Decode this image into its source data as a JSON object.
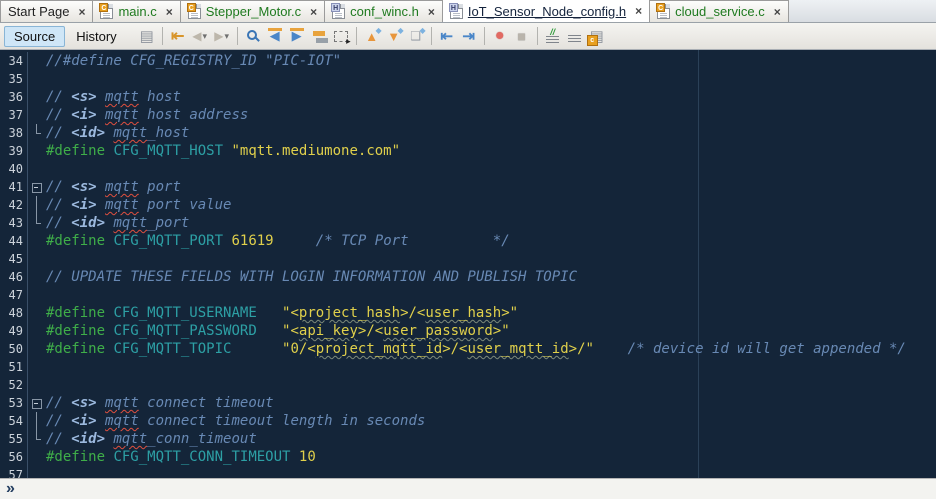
{
  "tabs": [
    {
      "label": "Start Page",
      "icon": null,
      "state": "plain"
    },
    {
      "label": "main.c",
      "icon": "c-file-icon",
      "state": "modified"
    },
    {
      "label": "Stepper_Motor.c",
      "icon": "c-file-icon",
      "state": "modified"
    },
    {
      "label": "conf_winc.h",
      "icon": "h-file-icon",
      "state": "modified"
    },
    {
      "label": "IoT_Sensor_Node_config.h",
      "icon": "h-file-icon",
      "state": "active"
    },
    {
      "label": "cloud_service.c",
      "icon": "c-file-icon",
      "state": "modified"
    }
  ],
  "toolbar": {
    "source_label": "Source",
    "history_label": "History",
    "icons": [
      "last-document",
      "sep",
      "jump-last-edit",
      "back",
      "forward",
      "sep",
      "find",
      "find-previous",
      "find-next",
      "toggle-highlight",
      "rectangular-selection",
      "sep",
      "previous-bookmark",
      "next-bookmark",
      "toggle-bookmark",
      "sep",
      "shift-left",
      "shift-right",
      "sep",
      "record-macro",
      "stop-macro",
      "sep",
      "comment",
      "uncomment",
      "goto-header-source"
    ]
  },
  "editor": {
    "first_line_number": 34,
    "last_line_number": 57,
    "lines": [
      {
        "num": 34,
        "fold": "",
        "segs": [
          [
            "c",
            "//#define CFG_REGISTRY_ID \"PIC-IOT\""
          ]
        ]
      },
      {
        "num": 35,
        "fold": "",
        "segs": []
      },
      {
        "num": 36,
        "fold": "",
        "segs": [
          [
            "c",
            "// "
          ],
          [
            "t",
            "<s>"
          ],
          [
            "c",
            " "
          ],
          [
            "ce",
            "mqtt"
          ],
          [
            "c",
            " host"
          ]
        ]
      },
      {
        "num": 37,
        "fold": "",
        "segs": [
          [
            "c",
            "// "
          ],
          [
            "t",
            "<i>"
          ],
          [
            "c",
            " "
          ],
          [
            "ce",
            "mqtt"
          ],
          [
            "c",
            " host address"
          ]
        ]
      },
      {
        "num": 38,
        "fold": "corner",
        "segs": [
          [
            "c",
            "// "
          ],
          [
            "t",
            "<id>"
          ],
          [
            "c",
            " "
          ],
          [
            "ce",
            "mqtt"
          ],
          [
            "c",
            "_host"
          ]
        ]
      },
      {
        "num": 39,
        "fold": "",
        "segs": [
          [
            "d",
            "#define"
          ],
          [
            "p",
            " "
          ],
          [
            "i",
            "CFG_MQTT_HOST"
          ],
          [
            "p",
            " "
          ],
          [
            "s",
            "\"mqtt.mediumone.com\""
          ]
        ]
      },
      {
        "num": 40,
        "fold": "",
        "segs": []
      },
      {
        "num": 41,
        "fold": "box",
        "segs": [
          [
            "c",
            "// "
          ],
          [
            "t",
            "<s>"
          ],
          [
            "c",
            " "
          ],
          [
            "ce",
            "mqtt"
          ],
          [
            "c",
            " port"
          ]
        ]
      },
      {
        "num": 42,
        "fold": "line",
        "segs": [
          [
            "c",
            "// "
          ],
          [
            "t",
            "<i>"
          ],
          [
            "c",
            " "
          ],
          [
            "ce",
            "mqtt"
          ],
          [
            "c",
            " port value"
          ]
        ]
      },
      {
        "num": 43,
        "fold": "corner",
        "segs": [
          [
            "c",
            "// "
          ],
          [
            "t",
            "<id>"
          ],
          [
            "c",
            " "
          ],
          [
            "ce",
            "mqtt"
          ],
          [
            "c",
            "_port"
          ]
        ]
      },
      {
        "num": 44,
        "fold": "",
        "segs": [
          [
            "d",
            "#define"
          ],
          [
            "p",
            " "
          ],
          [
            "i",
            "CFG_MQTT_PORT"
          ],
          [
            "p",
            " "
          ],
          [
            "n",
            "61619"
          ],
          [
            "p",
            "     "
          ],
          [
            "c",
            "/* TCP Port          */"
          ]
        ]
      },
      {
        "num": 45,
        "fold": "",
        "segs": []
      },
      {
        "num": 46,
        "fold": "",
        "segs": [
          [
            "c",
            "// UPDATE THESE FIELDS WITH LOGIN INFORMATION AND PUBLISH TOPIC"
          ]
        ]
      },
      {
        "num": 47,
        "fold": "",
        "segs": []
      },
      {
        "num": 48,
        "fold": "",
        "segs": [
          [
            "d",
            "#define"
          ],
          [
            "p",
            " "
          ],
          [
            "i",
            "CFG_MQTT_USERNAME"
          ],
          [
            "p",
            "   "
          ],
          [
            "s",
            "\"<"
          ],
          [
            "su",
            "project_hash"
          ],
          [
            "s",
            ">/<"
          ],
          [
            "su",
            "user_hash"
          ],
          [
            "s",
            ">\""
          ]
        ]
      },
      {
        "num": 49,
        "fold": "",
        "segs": [
          [
            "d",
            "#define"
          ],
          [
            "p",
            " "
          ],
          [
            "i",
            "CFG_MQTT_PASSWORD"
          ],
          [
            "p",
            "   "
          ],
          [
            "s",
            "\"<"
          ],
          [
            "su",
            "api_key"
          ],
          [
            "s",
            ">/<"
          ],
          [
            "su",
            "user_password"
          ],
          [
            "s",
            ">\""
          ]
        ]
      },
      {
        "num": 50,
        "fold": "",
        "segs": [
          [
            "d",
            "#define"
          ],
          [
            "p",
            " "
          ],
          [
            "i",
            "CFG_MQTT_TOPIC"
          ],
          [
            "p",
            "      "
          ],
          [
            "s",
            "\"0/<"
          ],
          [
            "su",
            "project_mqtt_id"
          ],
          [
            "s",
            ">/<"
          ],
          [
            "su",
            "user_mqtt_id"
          ],
          [
            "s",
            ">/\""
          ],
          [
            "p",
            "    "
          ],
          [
            "c",
            "/* device id will get appended */"
          ]
        ]
      },
      {
        "num": 51,
        "fold": "",
        "segs": []
      },
      {
        "num": 52,
        "fold": "",
        "segs": []
      },
      {
        "num": 53,
        "fold": "box",
        "segs": [
          [
            "c",
            "// "
          ],
          [
            "t",
            "<s>"
          ],
          [
            "c",
            " "
          ],
          [
            "ce",
            "mqtt"
          ],
          [
            "c",
            " connect timeout"
          ]
        ]
      },
      {
        "num": 54,
        "fold": "line",
        "segs": [
          [
            "c",
            "// "
          ],
          [
            "t",
            "<i>"
          ],
          [
            "c",
            " "
          ],
          [
            "ce",
            "mqtt"
          ],
          [
            "c",
            " connect timeout length in seconds"
          ]
        ]
      },
      {
        "num": 55,
        "fold": "corner",
        "segs": [
          [
            "c",
            "// "
          ],
          [
            "t",
            "<id>"
          ],
          [
            "c",
            " "
          ],
          [
            "ce",
            "mqtt"
          ],
          [
            "c",
            "_conn_timeout"
          ]
        ]
      },
      {
        "num": 56,
        "fold": "",
        "segs": [
          [
            "d",
            "#define"
          ],
          [
            "p",
            " "
          ],
          [
            "i",
            "CFG_MQTT_CONN_TIMEOUT"
          ],
          [
            "p",
            " "
          ],
          [
            "n",
            "10"
          ]
        ]
      },
      {
        "num": 57,
        "fold": "",
        "segs": []
      }
    ]
  },
  "breadcrumb": {
    "chevron": "»"
  },
  "colors": {
    "editor_background": "#142539",
    "directive_green": "#3fae49",
    "identifier_teal": "#2da0a5",
    "string_yellow": "#e0d04b",
    "comment_blue": "#6889b4",
    "doc_tag_blue": "#9cb9de",
    "error_underline_red": "#e04f3f",
    "modified_tab_green": "#1f7a1f",
    "source_toggle_blue": "#cfe6f7",
    "column_guide": "#2b4158"
  }
}
